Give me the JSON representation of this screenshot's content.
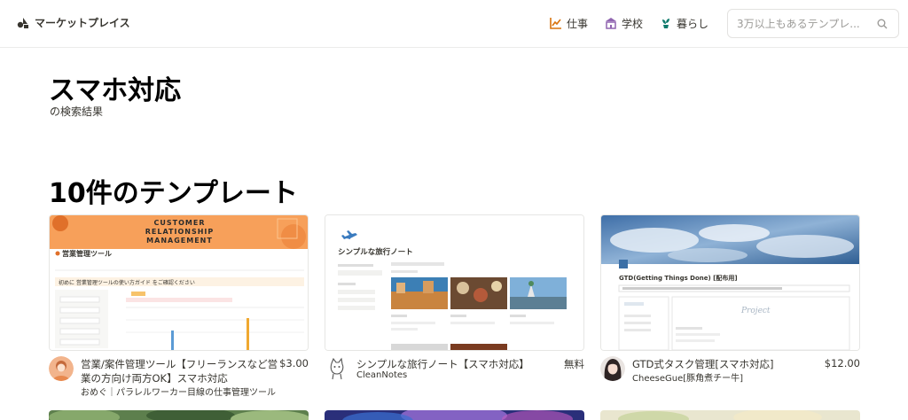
{
  "header": {
    "brand": "マーケットプレイス",
    "nav": [
      {
        "label": "仕事",
        "icon": "chart-icon",
        "color": "#d9730d"
      },
      {
        "label": "学校",
        "icon": "school-icon",
        "color": "#9065b0"
      },
      {
        "label": "暮らし",
        "icon": "plant-icon",
        "color": "#0f7b6c"
      }
    ],
    "search_placeholder": "3万以上もあるテンプレ..."
  },
  "page": {
    "title": "スマホ対応",
    "subtitle": "の検索結果",
    "count_title": "10件のテンプレート"
  },
  "cards": [
    {
      "title": "営業/案件管理ツール【フリーランスなど営業の方向け両方OK】スマホ対応",
      "price": "$3.00",
      "author": "おめぐ｜パラレルワーカー目線の仕事管理ツール",
      "thumb": {
        "banner_lines": [
          "Customer",
          "Relationship",
          "Management"
        ],
        "heading": "営業管理ツール",
        "notice": "初めに 営業管理ツールの使い方ガイド をご確認ください"
      }
    },
    {
      "title": "シンプルな旅行ノート【スマホ対応】",
      "price": "無料",
      "author": "CleanNotes",
      "thumb": {
        "heading": "シンプルな旅行ノート"
      }
    },
    {
      "title": "GTD式タスク管理[スマホ対応]",
      "price": "$12.00",
      "author": "CheeseGue[豚角煮チー牛]",
      "thumb": {
        "heading": "GTD(Getting Things Done) [配布用]",
        "project_label": "Project"
      }
    }
  ],
  "colors": {
    "accent_orange": "#f7a05a",
    "text": "#37352f"
  }
}
